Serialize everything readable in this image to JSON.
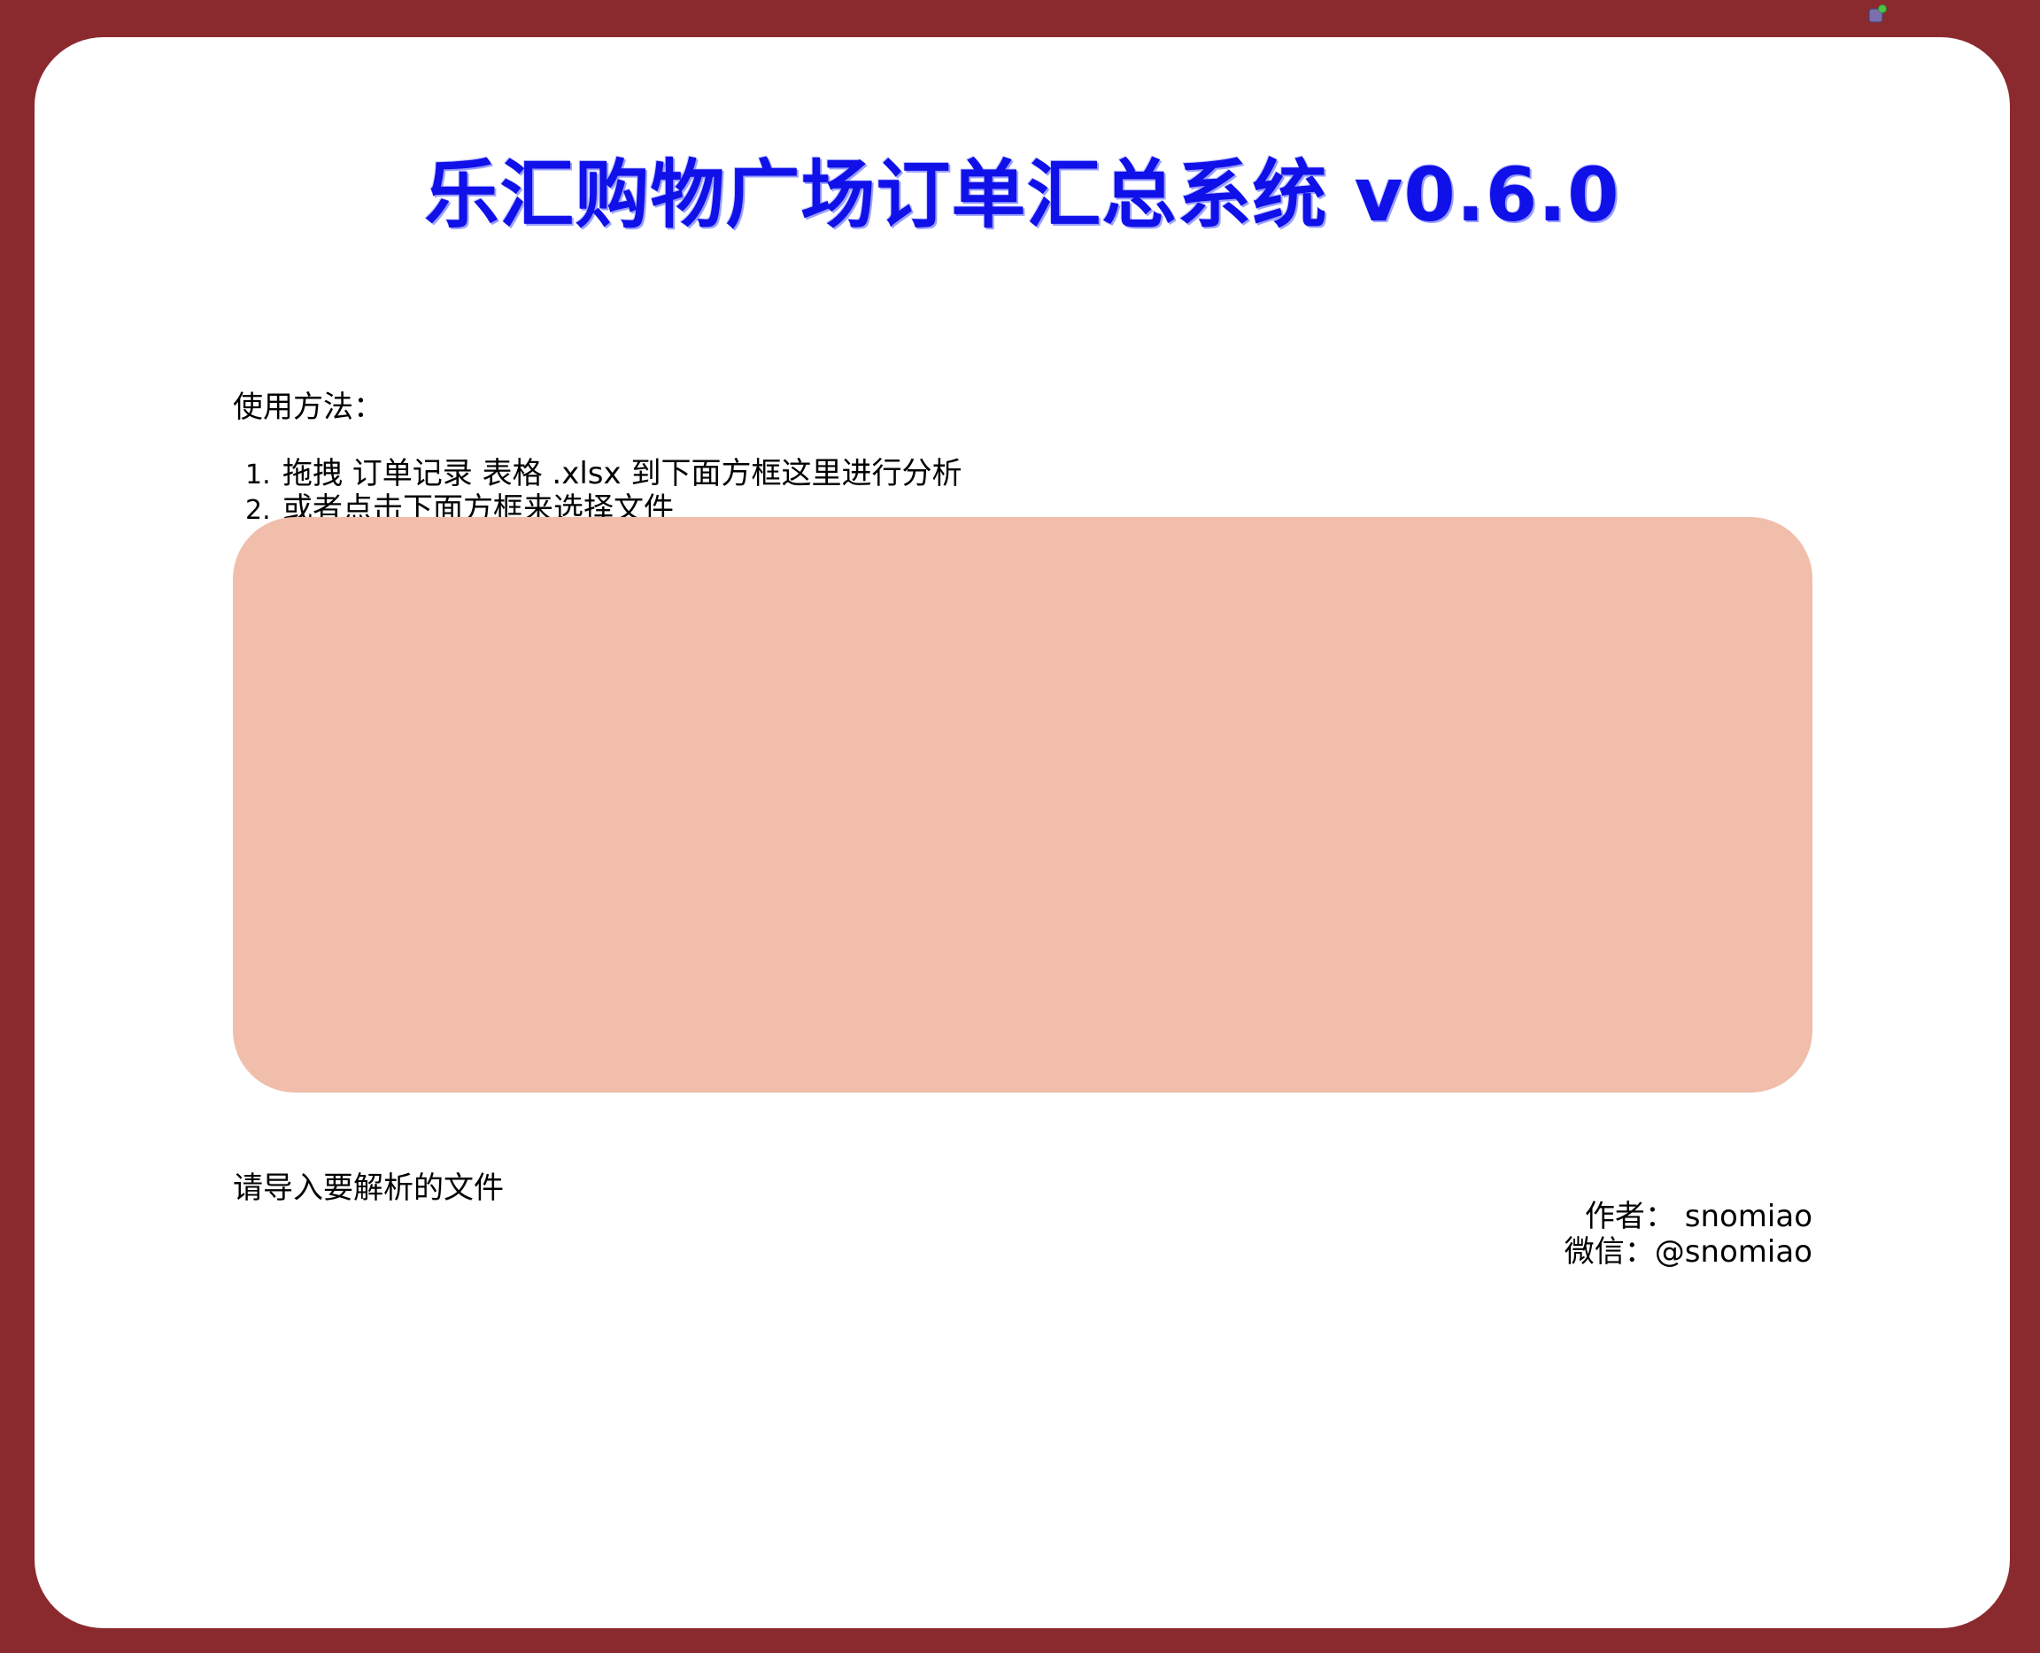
{
  "page": {
    "title": "乐汇购物广场订单汇总系统 v0.6.0"
  },
  "usage": {
    "heading": "使用方法：",
    "steps": [
      {
        "num": "1.",
        "text": "拖拽 订单记录 表格 .xlsx 到下面方框这里进行分析"
      },
      {
        "num": "2.",
        "text": "或者点击下面方框来选择文件"
      }
    ]
  },
  "status": {
    "text": "请导入要解析的文件"
  },
  "author": {
    "line1": "作者： snomiao",
    "line2": "微信：@snomiao"
  },
  "extension_icon": {
    "icon": "extension-badge-icon"
  },
  "colors": {
    "page_background": "#8b2a2e",
    "card_background": "#ffffff",
    "title_color": "#1010e8",
    "dropzone_color": "#f0beab"
  }
}
